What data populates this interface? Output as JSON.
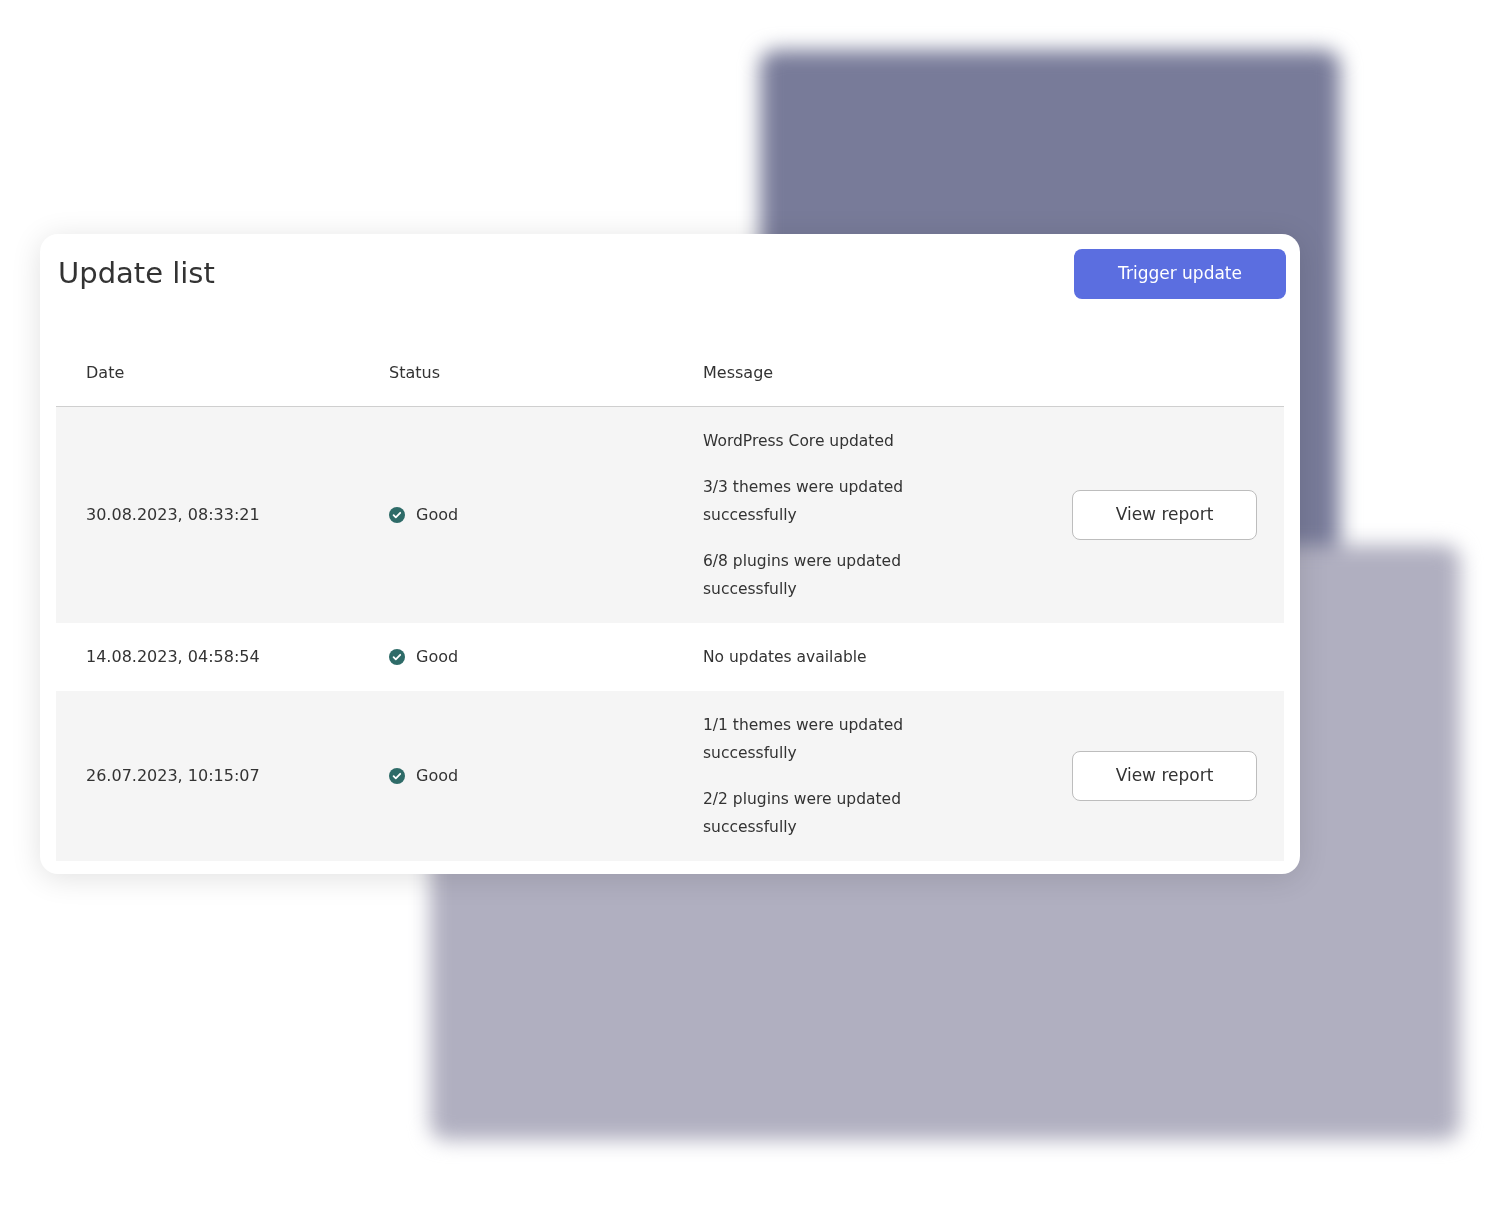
{
  "card": {
    "title": "Update list",
    "trigger_button": "Trigger update"
  },
  "table": {
    "columns": [
      "Date",
      "Status",
      "Message"
    ],
    "rows": [
      {
        "date": "30.08.2023, 08:33:21",
        "status": "Good",
        "color": "#2e6b68",
        "messages": [
          "WordPress Core updated",
          "3/3 themes were updated successfully",
          "6/8 plugins were updated successfully"
        ],
        "action": "View report"
      },
      {
        "date": "14.08.2023, 04:58:54",
        "status": "Good",
        "color": "#2e6b68",
        "messages": [
          "No updates available"
        ]
      },
      {
        "date": "26.07.2023, 10:15:07",
        "status": "Good",
        "color": "#2e6b68",
        "messages": [
          "1/1 themes were updated successfully",
          "2/2 plugins were updated successfully"
        ],
        "action": "View report"
      }
    ]
  }
}
